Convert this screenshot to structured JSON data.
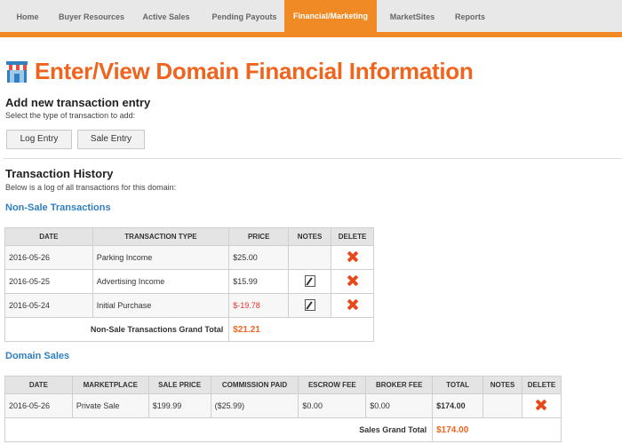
{
  "nav": {
    "tabs": [
      "Home",
      "Buyer Resources",
      "Active Sales",
      "Pending Payouts",
      "Financial/Marketing",
      "MarketSites",
      "Reports"
    ],
    "active_index": 4
  },
  "page": {
    "title": "Enter/View Domain Financial Information",
    "title_icon": "storefront-icon"
  },
  "add_entry": {
    "heading": "Add new transaction entry",
    "subtitle": "Select the type of transaction to add:",
    "log_button": "Log Entry",
    "sale_button": "Sale Entry"
  },
  "history": {
    "heading": "Transaction History",
    "subtitle": "Below is a log of all transactions for this domain:"
  },
  "non_sale": {
    "title": "Non-Sale Transactions",
    "columns": [
      "DATE",
      "TRANSACTION TYPE",
      "PRICE",
      "NOTES",
      "DELETE"
    ],
    "rows": [
      {
        "date": "2016-05-26",
        "type": "Parking Income",
        "price": "$25.00",
        "has_note": false
      },
      {
        "date": "2016-05-25",
        "type": "Advertising Income",
        "price": "$15.99",
        "has_note": true
      },
      {
        "date": "2016-05-24",
        "type": "Initial Purchase",
        "price": "$-19.78",
        "has_note": true
      }
    ],
    "total_label": "Non-Sale Transactions Grand Total",
    "total_value": "$21.21"
  },
  "domain_sales": {
    "title": "Domain Sales",
    "columns": [
      "DATE",
      "MARKETPLACE",
      "SALE PRICE",
      "COMMISSION PAID",
      "ESCROW FEE",
      "BROKER FEE",
      "TOTAL",
      "NOTES",
      "DELETE"
    ],
    "rows": [
      {
        "date": "2016-05-26",
        "marketplace": "Private Sale",
        "sale_price": "$199.99",
        "commission": "($25.99)",
        "escrow": "$0.00",
        "broker": "$0.00",
        "total": "$174.00"
      }
    ],
    "total_label": "Sales Grand Total",
    "total_value": "$174.00"
  },
  "colors": {
    "accent": "#f08a24",
    "title": "#f0641e",
    "link": "#2f7fc1",
    "negative": "#e3342f"
  }
}
